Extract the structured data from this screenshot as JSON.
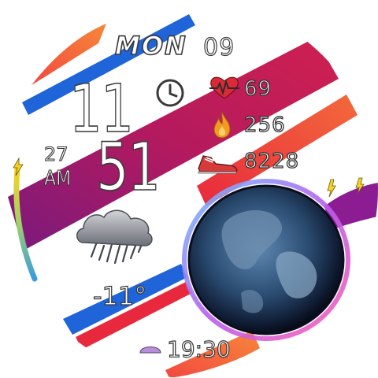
{
  "date": {
    "day": "MON",
    "date": "09"
  },
  "time": {
    "hour": "11",
    "minute": "51",
    "seconds": "27",
    "ampm": "AM"
  },
  "stats": {
    "heart_rate": "69",
    "calories": "256",
    "steps": "8228"
  },
  "weather": {
    "temperature": "-11°",
    "condition_icon": "rain-cloud-icon"
  },
  "sun": {
    "time": "19:30",
    "icon": "sunset-icon"
  },
  "icons": {
    "alarm": "clock-icon",
    "heart": "heart-rate-icon",
    "calories": "flame-icon",
    "steps": "shoe-icon",
    "battery": "battery-arc",
    "planet": "earth-globe"
  },
  "colors": {
    "stripe_magenta": "#b41a5e",
    "stripe_blue": "#1f64d8",
    "stripe_orange": "#f46a3a",
    "stripe_purple": "#8b1c92",
    "heart_red": "#d92a35",
    "flame_orange": "#f39a24",
    "shoe_red": "#d8393a",
    "battery_gradient_top": "#f7d320",
    "battery_gradient_bottom": "#3a9bde"
  }
}
